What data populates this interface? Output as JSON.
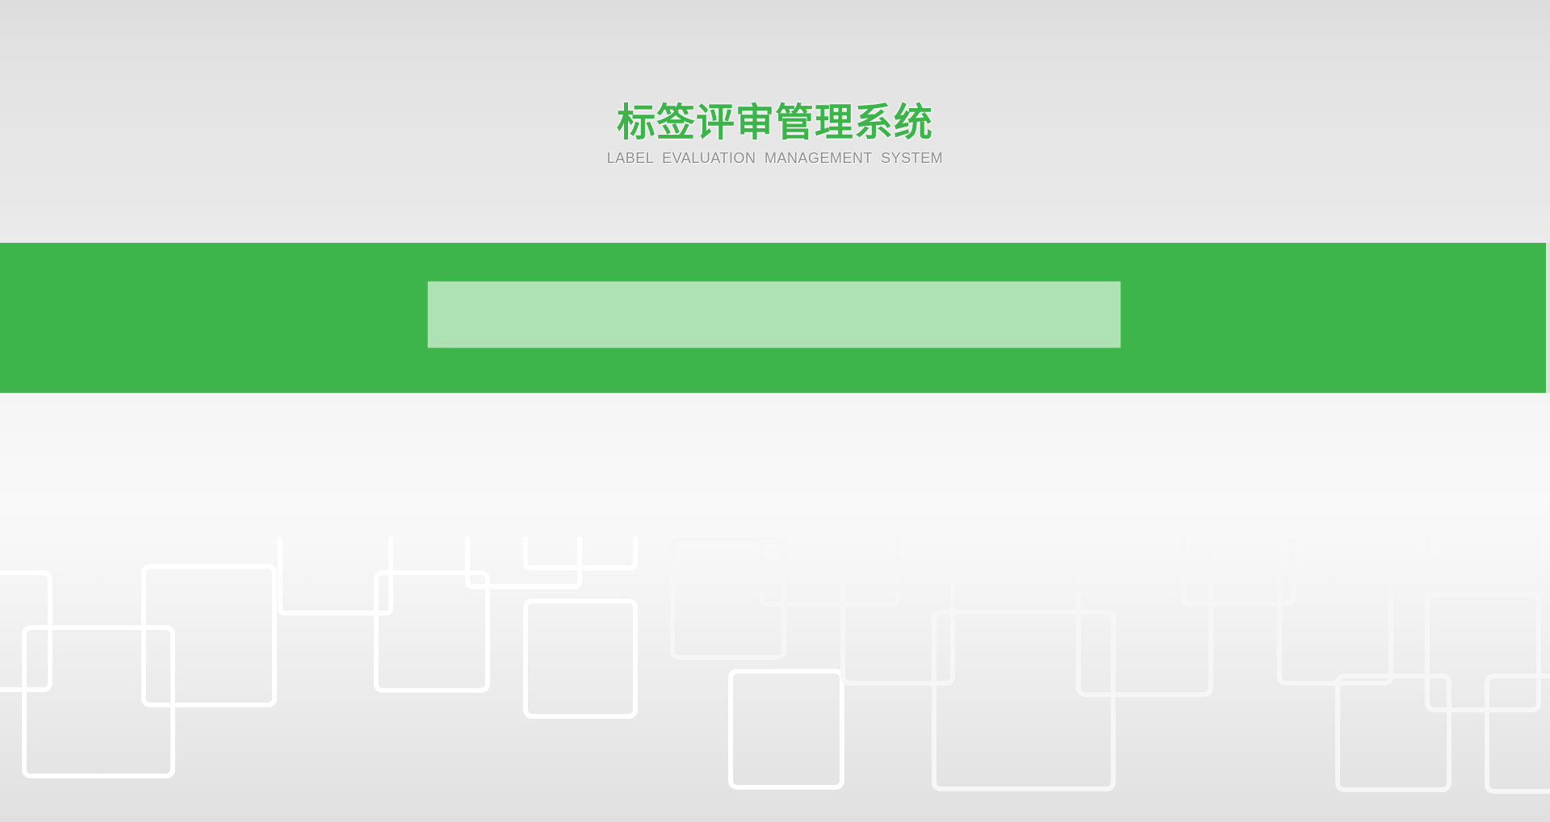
{
  "app": {
    "title": "标签评审管理系统",
    "subtitle": "LABEL EVALUATION MANAGEMENT SYSTEM"
  },
  "colors": {
    "brand_green": "#3db54a",
    "panel_green": "#aee1b4",
    "title_green": "#3db44a",
    "subtitle_gray": "#8f8f8f"
  },
  "decorations": {
    "background_pattern": "rounded-square-outlines"
  }
}
